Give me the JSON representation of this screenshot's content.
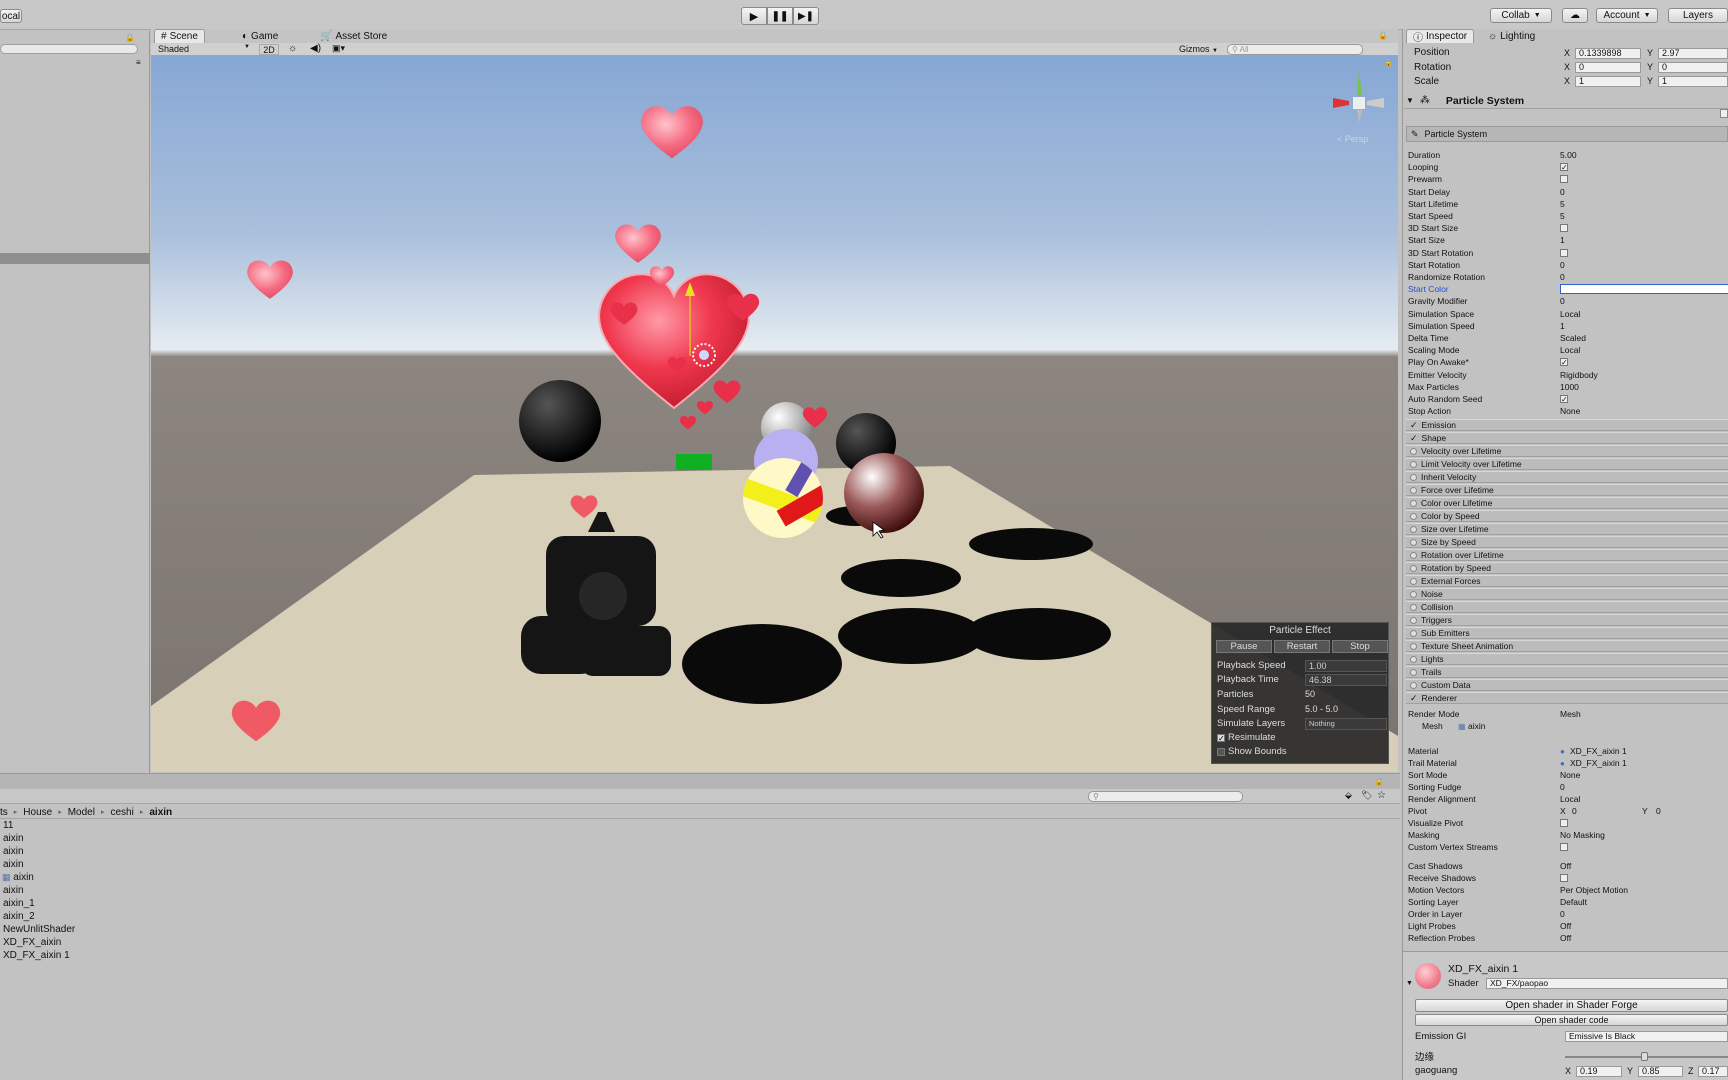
{
  "toolbar": {
    "left_button": "ocal",
    "collab": "Collab",
    "account": "Account",
    "layers": "Layers"
  },
  "scene_tabs": {
    "scene": "Scene",
    "game": "Game",
    "asset_store": "Asset Store"
  },
  "scene_toolbar": {
    "shading": "Shaded",
    "mode_2d": "2D",
    "gizmos": "Gizmos",
    "search_placeholder": "All"
  },
  "scene_view": {
    "persp_label": "< Persp"
  },
  "particle_effect": {
    "title": "Particle Effect",
    "pause": "Pause",
    "restart": "Restart",
    "stop": "Stop",
    "rows": [
      {
        "label": "Playback Speed",
        "value": "1.00"
      },
      {
        "label": "Playback Time",
        "value": "46.38"
      },
      {
        "label": "Particles",
        "value": "50"
      },
      {
        "label": "Speed Range",
        "value": "5.0 - 5.0"
      },
      {
        "label": "Simulate Layers",
        "value": "Nothing"
      }
    ],
    "resimulate": "Resimulate",
    "show_bounds": "Show Bounds"
  },
  "project": {
    "breadcrumb": [
      "ts",
      "House",
      "Model",
      "ceshi",
      "aixin"
    ],
    "items": [
      "11",
      "aixin",
      "aixin",
      "aixin",
      "aixin",
      "aixin",
      "aixin_1",
      "aixin_2",
      "NewUnlitShader",
      "XD_FX_aixin",
      "XD_FX_aixin 1"
    ]
  },
  "inspector": {
    "tabs": {
      "inspector": "Inspector",
      "lighting": "Lighting"
    },
    "transform": [
      {
        "label": "Position",
        "x": "0.1339898",
        "y": "2.97"
      },
      {
        "label": "Rotation",
        "x": "0",
        "y": "0"
      },
      {
        "label": "Scale",
        "x": "1",
        "y": "1"
      }
    ],
    "component_title": "Particle System",
    "subheader": "Particle System",
    "main_props": [
      {
        "label": "Duration",
        "value": "5.00"
      },
      {
        "label": "Looping",
        "value": "✓"
      },
      {
        "label": "Prewarm",
        "value": ""
      },
      {
        "label": "Start Delay",
        "value": "0"
      },
      {
        "label": "Start Lifetime",
        "value": "5"
      },
      {
        "label": "Start Speed",
        "value": "5"
      },
      {
        "label": "3D Start Size",
        "value": ""
      },
      {
        "label": "Start Size",
        "value": "1"
      },
      {
        "label": "3D Start Rotation",
        "value": ""
      },
      {
        "label": "Start Rotation",
        "value": "0"
      },
      {
        "label": "Randomize Rotation",
        "value": "0"
      },
      {
        "label": "Start Color",
        "value": ""
      },
      {
        "label": "Gravity Modifier",
        "value": "0"
      },
      {
        "label": "Simulation Space",
        "value": "Local"
      },
      {
        "label": "Simulation Speed",
        "value": "1"
      },
      {
        "label": "Delta Time",
        "value": "Scaled"
      },
      {
        "label": "Scaling Mode",
        "value": "Local"
      },
      {
        "label": "Play On Awake*",
        "value": "✓"
      },
      {
        "label": "Emitter Velocity",
        "value": "Rigidbody"
      },
      {
        "label": "Max Particles",
        "value": "1000"
      },
      {
        "label": "Auto Random Seed",
        "value": "✓"
      },
      {
        "label": "Stop Action",
        "value": "None"
      }
    ],
    "modules": [
      {
        "label": "Emission",
        "on": "✓"
      },
      {
        "label": "Shape",
        "on": "✓"
      },
      {
        "label": "Velocity over Lifetime",
        "on": ""
      },
      {
        "label": "Limit Velocity over Lifetime",
        "on": ""
      },
      {
        "label": "Inherit Velocity",
        "on": ""
      },
      {
        "label": "Force over Lifetime",
        "on": ""
      },
      {
        "label": "Color over Lifetime",
        "on": ""
      },
      {
        "label": "Color by Speed",
        "on": ""
      },
      {
        "label": "Size over Lifetime",
        "on": ""
      },
      {
        "label": "Size by Speed",
        "on": ""
      },
      {
        "label": "Rotation over Lifetime",
        "on": ""
      },
      {
        "label": "Rotation by Speed",
        "on": ""
      },
      {
        "label": "External Forces",
        "on": ""
      },
      {
        "label": "Noise",
        "on": ""
      },
      {
        "label": "Collision",
        "on": ""
      },
      {
        "label": "Triggers",
        "on": ""
      },
      {
        "label": "Sub Emitters",
        "on": ""
      },
      {
        "label": "Texture Sheet Animation",
        "on": ""
      },
      {
        "label": "Lights",
        "on": ""
      },
      {
        "label": "Trails",
        "on": ""
      },
      {
        "label": "Custom Data",
        "on": ""
      },
      {
        "label": "Renderer",
        "on": "✓"
      }
    ],
    "renderer": [
      {
        "label": "Render Mode",
        "value": "Mesh"
      },
      {
        "label": "Mesh",
        "value": "aixin"
      },
      {
        "label": "Material",
        "value": "XD_FX_aixin 1"
      },
      {
        "label": "Trail Material",
        "value": "XD_FX_aixin 1"
      },
      {
        "label": "Sort Mode",
        "value": "None"
      },
      {
        "label": "Sorting Fudge",
        "value": "0"
      },
      {
        "label": "Render Alignment",
        "value": "Local"
      },
      {
        "label": "Pivot",
        "value": ""
      },
      {
        "label": "Visualize Pivot",
        "value": ""
      },
      {
        "label": "Masking",
        "value": "No Masking"
      },
      {
        "label": "Custom Vertex Streams",
        "value": ""
      },
      {
        "label": "Cast Shadows",
        "value": "Off"
      },
      {
        "label": "Receive Shadows",
        "value": ""
      },
      {
        "label": "Motion Vectors",
        "value": "Per Object Motion"
      },
      {
        "label": "Sorting Layer",
        "value": "Default"
      },
      {
        "label": "Order in Layer",
        "value": "0"
      },
      {
        "label": "Light Probes",
        "value": "Off"
      },
      {
        "label": "Reflection Probes",
        "value": "Off"
      }
    ],
    "pivot": {
      "x": "0",
      "y": "0"
    },
    "material": {
      "name": "XD_FX_aixin 1",
      "shader_label": "Shader",
      "shader": "XD_FX/paopao",
      "open_forge": "Open shader in Shader Forge",
      "open_code": "Open shader code",
      "emission_label": "Emission GI",
      "emission_value": "Emissive Is Black",
      "biandao": "边缘",
      "gaoguang": "gaoguang",
      "gaoguang_x": "0.19",
      "gaoguang_y": "0.85",
      "gaoguang_z": "0.17"
    }
  }
}
